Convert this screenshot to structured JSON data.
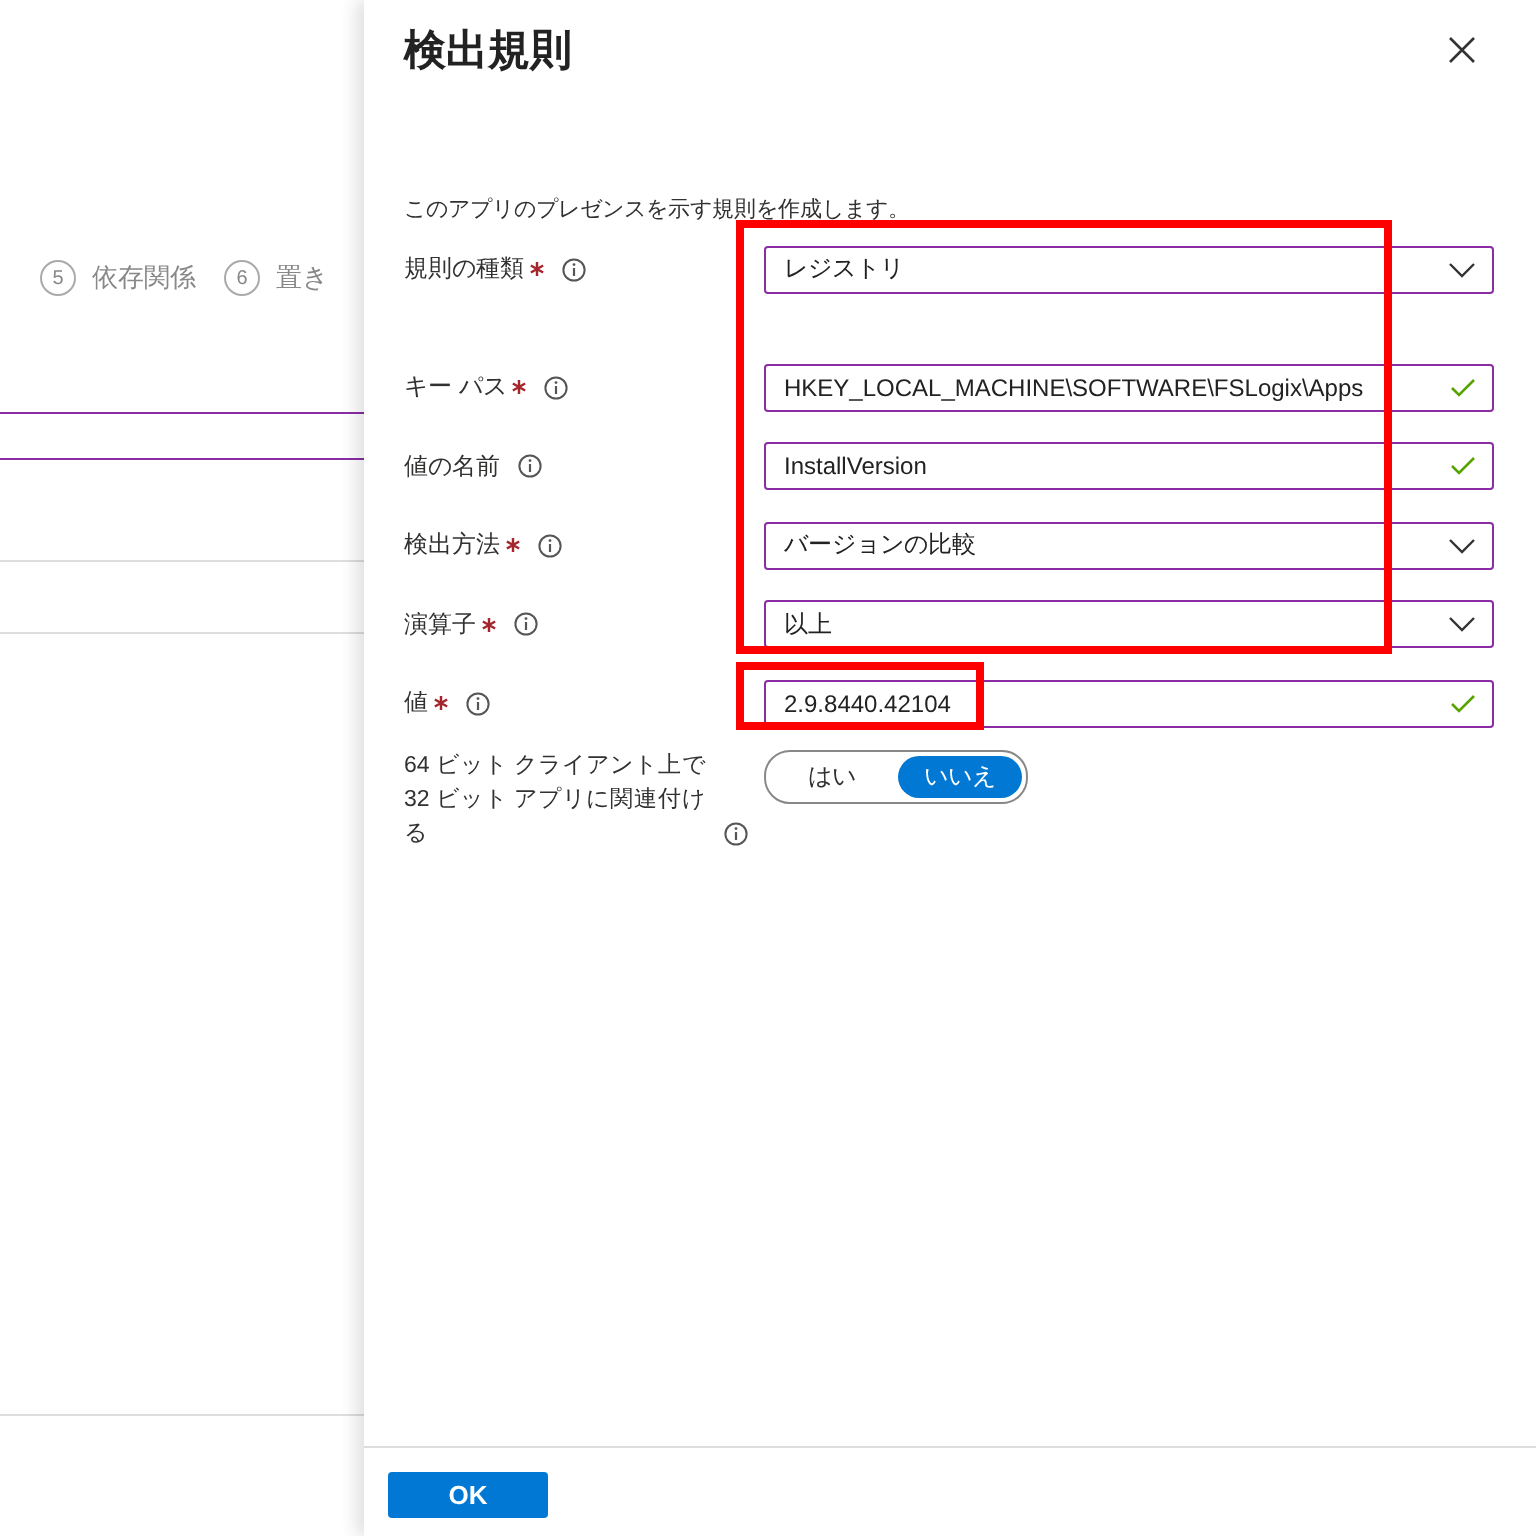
{
  "background_steps": [
    {
      "number": "5",
      "label": "依存関係"
    },
    {
      "number": "6",
      "label": "置き"
    }
  ],
  "panel": {
    "title": "検出規則",
    "description": "このアプリのプレゼンスを示す規則を作成します。",
    "fields": [
      {
        "label": "規則の種類",
        "required": true,
        "kind": "dropdown",
        "value": "レジストリ"
      },
      {
        "label": "キー パス",
        "required": true,
        "kind": "text",
        "value": "HKEY_LOCAL_MACHINE\\SOFTWARE\\FSLogix\\Apps",
        "valid": true
      },
      {
        "label": "値の名前",
        "required": false,
        "kind": "text",
        "value": "InstallVersion",
        "valid": true
      },
      {
        "label": "検出方法",
        "required": true,
        "kind": "dropdown",
        "value": "バージョンの比較"
      },
      {
        "label": "演算子",
        "required": true,
        "kind": "dropdown",
        "value": "以上"
      },
      {
        "label": "値",
        "required": true,
        "kind": "text",
        "value": "2.9.8440.42104",
        "valid": true
      }
    ],
    "toggle": {
      "label": "64 ビット クライアント上で 32 ビット アプリに関連付ける",
      "options": [
        {
          "label": "はい",
          "selected": false
        },
        {
          "label": "いいえ",
          "selected": true
        }
      ]
    },
    "ok_button": "OK"
  }
}
